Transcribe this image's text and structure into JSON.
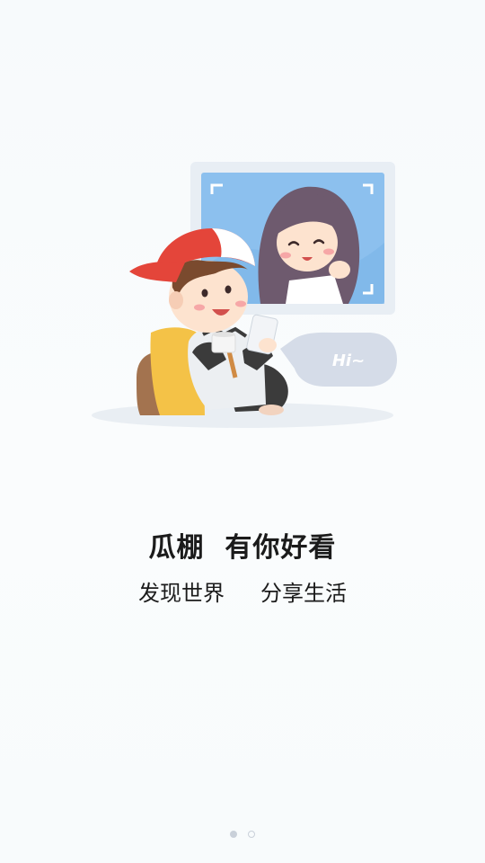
{
  "onboarding": {
    "title": "瓜棚  有你好看",
    "subtitle_left": "发现世界",
    "subtitle_right": "分享生活",
    "speech_bubble": "Hi~",
    "pager": {
      "page_count": 2,
      "current_page": 1
    }
  },
  "colors": {
    "background": "#f8fbfd",
    "text": "#1b1b1b",
    "frame": "#e8eef4",
    "screen_blue": "#8cc0ee",
    "bubble": "#d5dce8",
    "cap_red": "#e4453a",
    "cushion_yellow": "#f4c247",
    "pager_dot": "#c9d0d9"
  },
  "icons": {
    "illustration": "boy-video-chat-illustration",
    "pager_dot": "dot-icon"
  }
}
